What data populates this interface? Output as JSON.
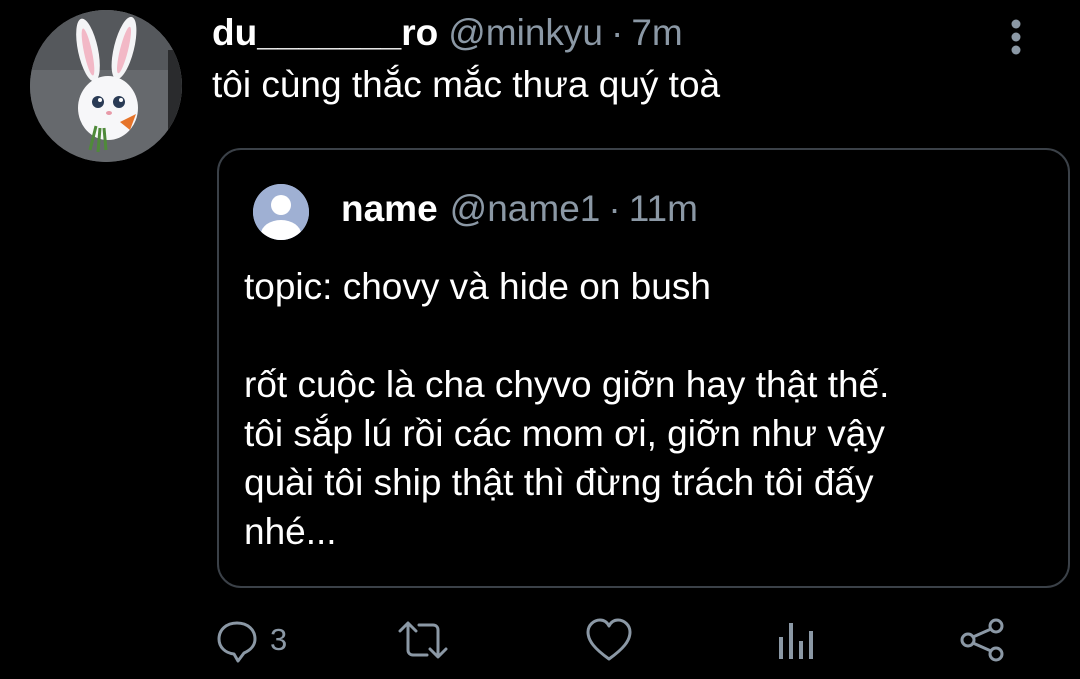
{
  "tweet": {
    "author": {
      "display_name": "du_______ro",
      "handle": "@minkyu",
      "separator": "·",
      "time": "7m",
      "avatar_icon": "bunny-avatar-icon"
    },
    "text": "tôi cùng thắc mắc thưa quý toà",
    "more_icon": "more-vertical-icon"
  },
  "quoted": {
    "author": {
      "display_name": "name",
      "handle": "@name1",
      "separator": "·",
      "time": "11m",
      "avatar_icon": "default-user-icon"
    },
    "lines": [
      "topic: chovy và hide on bush",
      "",
      "rốt cuộc là cha chyvo giỡn hay thật thế.",
      "tôi sắp lú rồi các mom ơi, giỡn như vậy",
      "quài tôi ship thật thì đừng trách tôi đấy",
      "nhé..."
    ]
  },
  "actions": {
    "reply": {
      "icon": "reply-icon",
      "count": "3"
    },
    "retweet": {
      "icon": "retweet-icon"
    },
    "like": {
      "icon": "heart-icon"
    },
    "analytics": {
      "icon": "analytics-icon"
    },
    "share": {
      "icon": "share-icon"
    }
  },
  "colors": {
    "background": "#000000",
    "text": "#ffffff",
    "muted": "#8b98a5",
    "border": "#3b4148"
  }
}
